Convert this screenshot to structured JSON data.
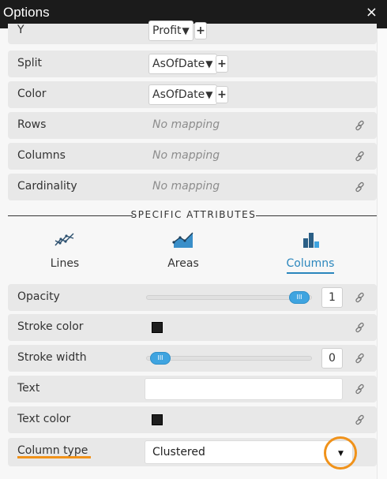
{
  "window": {
    "title": "Options",
    "close_glyph": "×"
  },
  "mappings": [
    {
      "label": "Y",
      "value": "Profit",
      "has_add": true
    },
    {
      "label": "Split",
      "value": "AsOfDate",
      "has_add": true
    },
    {
      "label": "Color",
      "value": "AsOfDate",
      "has_add": true
    },
    {
      "label": "Rows",
      "placeholder": "No mapping"
    },
    {
      "label": "Columns",
      "placeholder": "No mapping"
    },
    {
      "label": "Cardinality",
      "placeholder": "No mapping"
    }
  ],
  "dropdown_glyph": "▼",
  "add_glyph": "+",
  "section": {
    "title": "SPECIFIC ATTRIBUTES"
  },
  "chart_types": [
    {
      "label": "Lines",
      "icon": "line-chart-icon",
      "selected": false
    },
    {
      "label": "Areas",
      "icon": "area-chart-icon",
      "selected": false
    },
    {
      "label": "Columns",
      "icon": "column-chart-icon",
      "selected": true
    }
  ],
  "attributes": {
    "opacity": {
      "label": "Opacity",
      "value": "1",
      "slider_fraction": 1.0
    },
    "stroke_color": {
      "label": "Stroke color",
      "color": "#1e1e1e"
    },
    "stroke_width": {
      "label": "Stroke width",
      "value": "0",
      "slider_fraction": 0.0
    },
    "text": {
      "label": "Text",
      "value": ""
    },
    "text_color": {
      "label": "Text color",
      "color": "#1e1e1e"
    },
    "column_type": {
      "label": "Column type",
      "value": "Clustered"
    }
  },
  "thumb_glyph": "III",
  "colors": {
    "accent": "#2a86bd",
    "highlight": "#f0921a",
    "titlebar": "#1b1b1b"
  }
}
